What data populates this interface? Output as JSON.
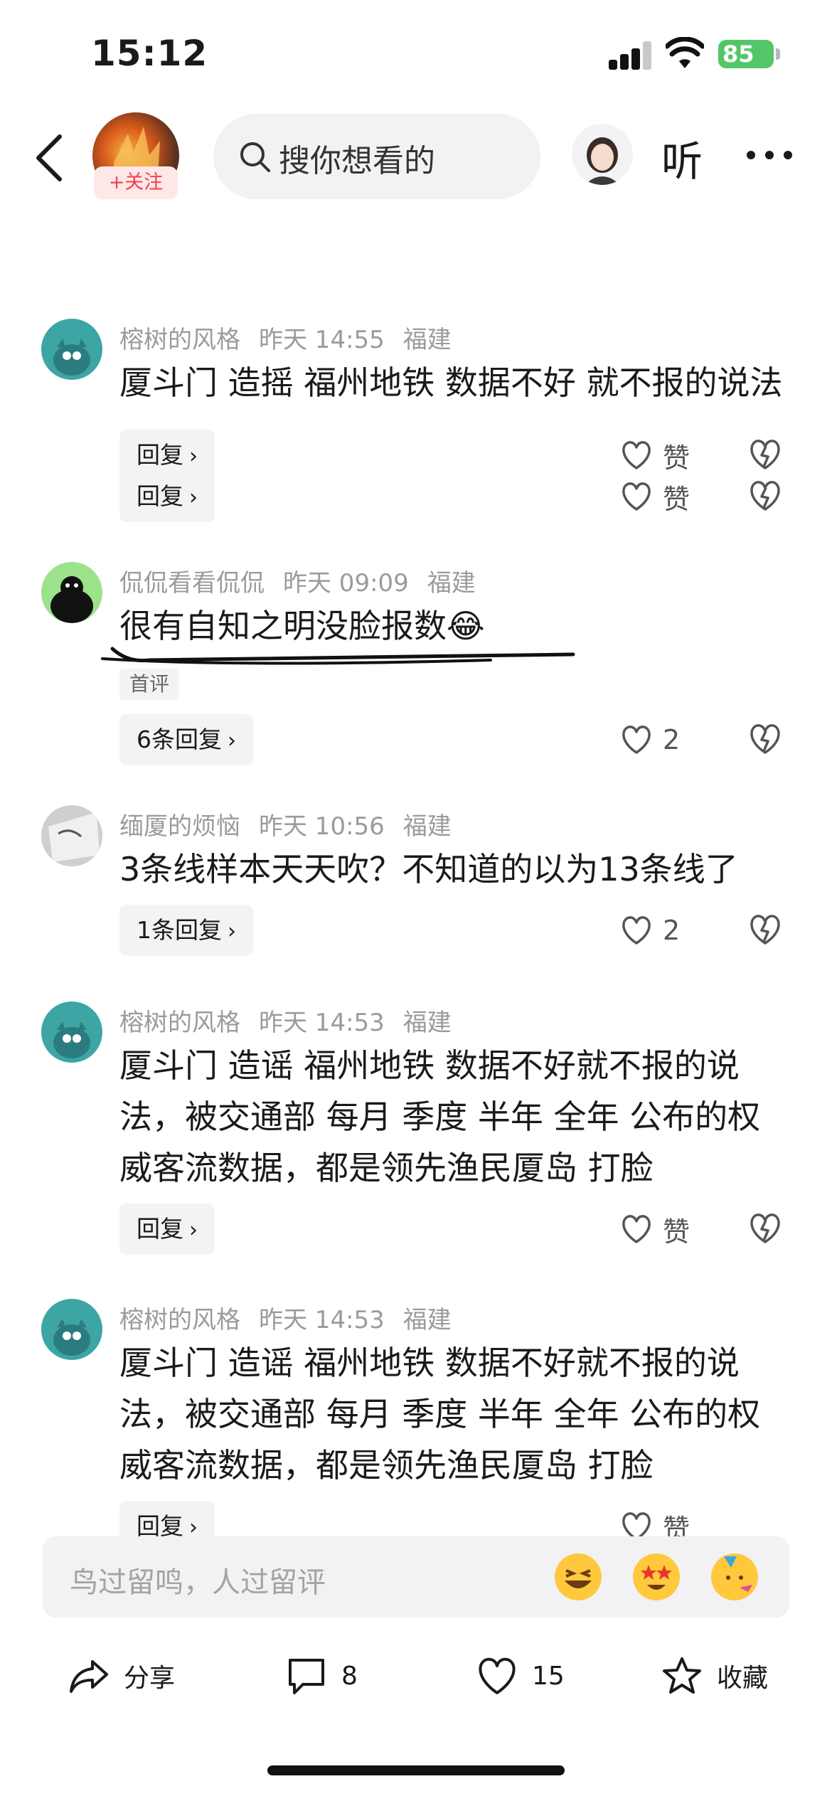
{
  "status": {
    "time": "15:12",
    "battery": "85"
  },
  "header": {
    "follow_label": "+关注",
    "search_placeholder": "搜你想看的",
    "listen_label": "听"
  },
  "comments": [
    {
      "author": "",
      "time": "",
      "location": "",
      "text": "",
      "reply_label": "回复",
      "like_label": "赞"
    },
    {
      "author": "榕树的风格",
      "time": "昨天 14:55",
      "location": "福建",
      "text": "厦斗门 造摇 福州地铁 数据不好 就不报的说法",
      "reply_label": "回复",
      "like_label": "赞"
    },
    {
      "author": "侃侃看看侃侃",
      "time": "昨天 09:09",
      "location": "福建",
      "text": "很有自知之明没脸报数😂",
      "badge": "首评",
      "reply_label": "6条回复",
      "like_label": "2"
    },
    {
      "author": "缅厦的烦恼",
      "time": "昨天 10:56",
      "location": "福建",
      "text": "3条线样本天天吹？不知道的以为13条线了",
      "reply_label": "1条回复",
      "like_label": "2"
    },
    {
      "author": "榕树的风格",
      "time": "昨天 14:53",
      "location": "福建",
      "text": "厦斗门 造谣 福州地铁 数据不好就不报的说法，被交通部 每月 季度 半年 全年 公布的权威客流数据，都是领先渔民厦岛 打脸",
      "reply_label": "回复",
      "like_label": "赞"
    },
    {
      "author": "榕树的风格",
      "time": "昨天 14:53",
      "location": "福建",
      "text": "厦斗门 造谣 福州地铁 数据不好就不报的说法，被交通部 每月 季度 半年 全年 公布的权威客流数据，都是领先渔民厦岛 打脸",
      "reply_label": "回复",
      "like_label": "赞"
    }
  ],
  "composer": {
    "placeholder": "鸟过留鸣，人过留评"
  },
  "actions": {
    "share_label": "分享",
    "comment_count": "8",
    "like_count": "15",
    "favorite_label": "收藏"
  },
  "colors": {
    "accent_red": "#f2424f",
    "battery_green": "#53c668",
    "chip_bg": "#f3f3f5",
    "meta_gray": "#9b9b9b"
  }
}
